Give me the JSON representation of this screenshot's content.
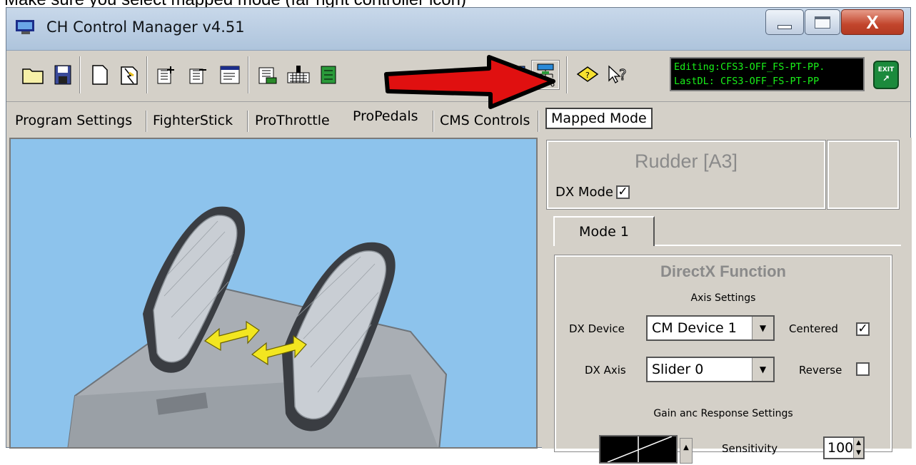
{
  "caption": "Make sure you select mapped mode (far right controller icon)",
  "window": {
    "title": "CH Control Manager v4.51",
    "close_label": "X"
  },
  "toolbar": {
    "status_line1": "Editing:CFS3-OFF_FS-PT-PP.",
    "status_line2": "LastDL: CFS3-OFF_FS-PT-PP",
    "exit_label": "EXIT"
  },
  "tabs": [
    "Program Settings",
    "FighterStick",
    "ProThrottle",
    "ProPedals",
    "CMS Controls"
  ],
  "mapped_mode_label": "Mapped Mode",
  "rudder": {
    "title": "Rudder [A3]",
    "dx_mode_label": "DX Mode",
    "dx_mode_checked": true
  },
  "mode_tab": "Mode 1",
  "directx": {
    "title": "DirectX Function",
    "axis_settings_label": "Axis Settings",
    "dx_device_label": "DX Device",
    "dx_device_value": "CM Device 1",
    "centered_label": "Centered",
    "centered_checked": true,
    "dx_axis_label": "DX Axis",
    "dx_axis_value": "Slider 0",
    "reverse_label": "Reverse",
    "reverse_checked": false,
    "gain_label": "Gain anc Response Settings",
    "sensitivity_label": "Sensitivity",
    "sensitivity_value": "100"
  },
  "colors": {
    "status_text": "#19f019",
    "image_bg": "#8dc3ec",
    "arrow": "#e01010",
    "close_button": "#c2452c"
  }
}
